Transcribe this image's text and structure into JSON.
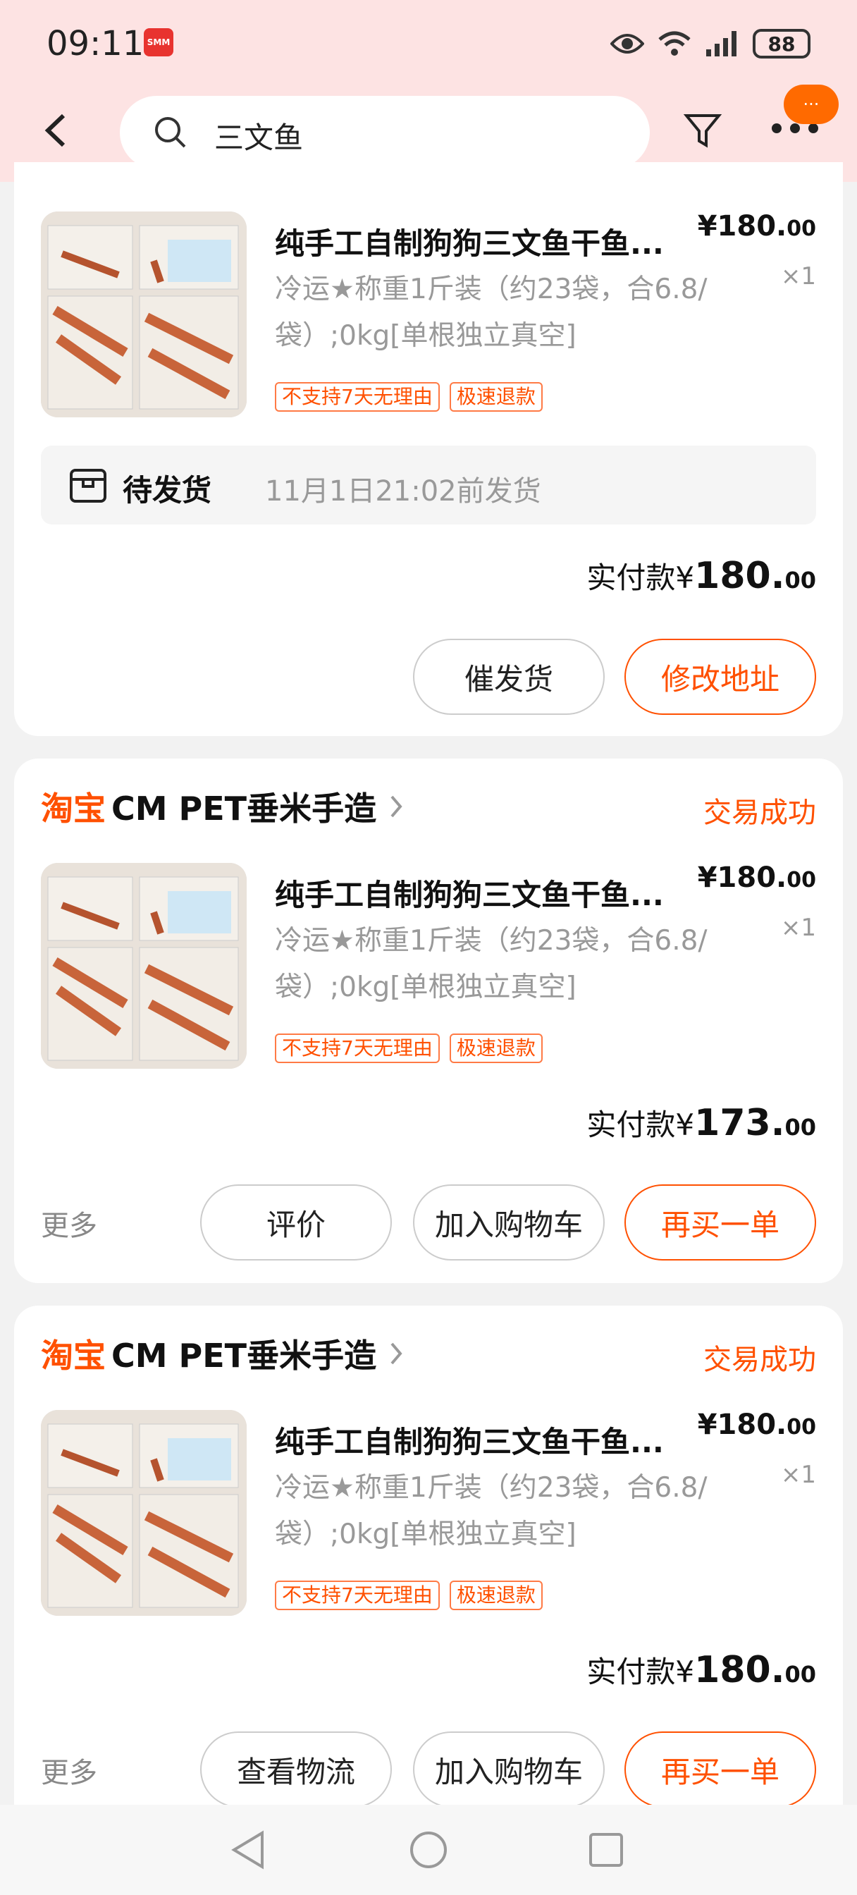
{
  "status_bar": {
    "time": "09:11",
    "app_badge": "SMM",
    "battery": "88"
  },
  "header": {
    "search_query": "三文鱼",
    "notification_bubble": "···"
  },
  "orders": [
    {
      "shop_prefix": "",
      "shop_name": "",
      "status": "",
      "product": {
        "title": "纯手工自制狗狗三文鱼干鱼...",
        "sku": "冷运★称重1斤装（约23袋，合6.8/袋）;0kg[单根独立真空]",
        "tags": [
          "不支持7天无理由",
          "极速退款"
        ],
        "price_main": "¥180.",
        "price_cents": "00",
        "qty": "×1"
      },
      "shipping": {
        "label": "待发货",
        "time": "11月1日21:02前发货"
      },
      "paid": {
        "label": "实付款",
        "currency": "¥",
        "amount": "180.",
        "cents": "00"
      },
      "buttons": [
        "催发货",
        "修改地址"
      ]
    },
    {
      "shop_prefix": "淘宝",
      "shop_name": "CM PET垂米手造",
      "status": "交易成功",
      "product": {
        "title": "纯手工自制狗狗三文鱼干鱼...",
        "sku": "冷运★称重1斤装（约23袋，合6.8/袋）;0kg[单根独立真空]",
        "tags": [
          "不支持7天无理由",
          "极速退款"
        ],
        "price_main": "¥180.",
        "price_cents": "00",
        "qty": "×1"
      },
      "paid": {
        "label": "实付款",
        "currency": "¥",
        "amount": "173.",
        "cents": "00"
      },
      "more_label": "更多",
      "buttons": [
        "评价",
        "加入购物车",
        "再买一单"
      ]
    },
    {
      "shop_prefix": "淘宝",
      "shop_name": "CM PET垂米手造",
      "status": "交易成功",
      "product": {
        "title": "纯手工自制狗狗三文鱼干鱼...",
        "sku": "冷运★称重1斤装（约23袋，合6.8/袋）;0kg[单根独立真空]",
        "tags": [
          "不支持7天无理由",
          "极速退款"
        ],
        "price_main": "¥180.",
        "price_cents": "00",
        "qty": "×1"
      },
      "paid": {
        "label": "实付款",
        "currency": "¥",
        "amount": "180.",
        "cents": "00"
      },
      "more_label": "更多",
      "buttons": [
        "查看物流",
        "加入购物车",
        "再买一单"
      ]
    }
  ],
  "colors": {
    "accent": "#ff5000",
    "header_bg": "#fde3e3"
  }
}
